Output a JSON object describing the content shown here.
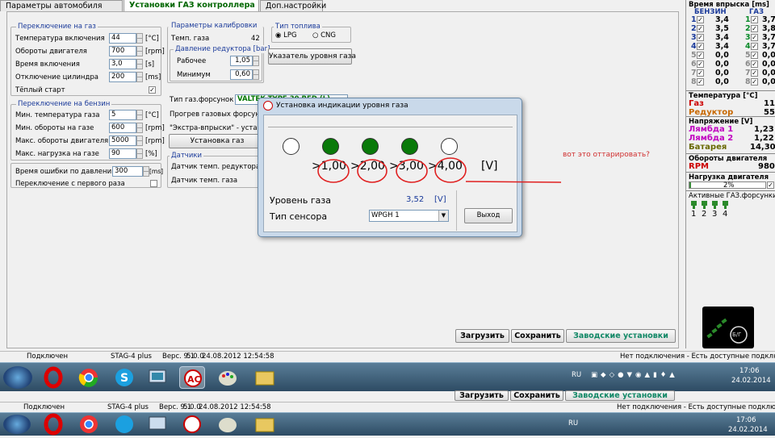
{
  "tabs": [
    "Параметры автомобиля",
    "Установки ГАЗ контроллера",
    "Доп.настройки"
  ],
  "switch_gas": {
    "title": "Переключение на газ",
    "rows": [
      {
        "label": "Температура включения",
        "value": "44",
        "unit": "[°C]"
      },
      {
        "label": "Обороты двигателя",
        "value": "700",
        "unit": "[rpm]"
      },
      {
        "label": "Время включения",
        "value": "3,0",
        "unit": "[s]"
      },
      {
        "label": "Отключение цилиндра",
        "value": "200",
        "unit": "[ms]"
      }
    ],
    "warm_start": "Тёплый старт"
  },
  "switch_petrol": {
    "title": "Переключение на бензин",
    "rows": [
      {
        "label": "Мин. температура газа",
        "value": "5",
        "unit": "[°C]"
      },
      {
        "label": "Мин. обороты на газе",
        "value": "600",
        "unit": "[rpm]"
      },
      {
        "label": "Макс. обороты двигателя",
        "value": "5000",
        "unit": "[rpm]"
      },
      {
        "label": "Макс. нагрузка на газе",
        "value": "90",
        "unit": "[%]"
      }
    ]
  },
  "pressure_err": {
    "label": "Время ошибки по давлению",
    "value": "300",
    "unit": "[ms]"
  },
  "first_switch": "Переключение с первого раза",
  "calib": {
    "title": "Параметры калибровки",
    "gas_temp_label": "Темп. газа",
    "gas_temp_value": "42",
    "reducer_title": "Давление редуктора [bar]",
    "work_label": "Рабочее",
    "work_value": "1,05",
    "min_label": "Минимум",
    "min_value": "0,60"
  },
  "fuel": {
    "title": "Тип топлива",
    "lpg": "LPG",
    "cng": "CNG"
  },
  "level_btn": "Указатель уровня газа",
  "injectors": {
    "label": "Тип газ.форсунок",
    "value": "VALTEK TYPE 30 RED (L)",
    "preheat": "Прогрев газовых форсунок",
    "extra": "\"Экстра-впрыски\" - установ",
    "install": "Установка газ"
  },
  "sensors": {
    "title": "Датчики",
    "reducer": "Датчик темп. редуктора",
    "gas": "Датчик темп. газа"
  },
  "buttons": {
    "load": "Загрузить",
    "save": "Сохранить",
    "factory": "Заводские установки"
  },
  "annotation": "вот это оттарировать?",
  "right": {
    "inj_title": "Время впрыска [ms]",
    "petrol": "БЕНЗИН",
    "gas": "ГАЗ",
    "inj": [
      {
        "n": "1",
        "b": "3,4",
        "g": "3,7"
      },
      {
        "n": "2",
        "b": "3,5",
        "g": "3,8"
      },
      {
        "n": "3",
        "b": "3,4",
        "g": "3,7"
      },
      {
        "n": "4",
        "b": "3,4",
        "g": "3,7"
      },
      {
        "n": "5",
        "b": "0,0",
        "g": "0,0"
      },
      {
        "n": "6",
        "b": "0,0",
        "g": "0,0"
      },
      {
        "n": "7",
        "b": "0,0",
        "g": "0,0"
      },
      {
        "n": "8",
        "b": "0,0",
        "g": "0,0"
      }
    ],
    "temp_title": "Температура [°C]",
    "gas_label": "Газ",
    "gas_val": "11",
    "reducer_label": "Редуктор",
    "reducer_val": "55",
    "volt_title": "Напряжение [V]",
    "l1": "Лямбда 1",
    "l1v": "1,23",
    "l2": "Лямбда 2",
    "l2v": "1,22",
    "bat": "Батарея",
    "batv": "14,30",
    "rpm_title": "Обороты двигателя",
    "rpm_label": "RPM",
    "rpm_val": "980",
    "load_title": "Нагрузка двигателя",
    "load_val": "2%",
    "load_frac": 0.02,
    "active_title": "Активные ГАЗ.форсунки",
    "active_nums": [
      "1",
      "2",
      "3",
      "4"
    ],
    "switch_label": "Б/Г"
  },
  "status": {
    "state": "Подключен",
    "device": "STAG-4 plus",
    "ver": "Верс. 9.1",
    "fw": "5.0.0",
    "date": "24.08.2012 12:54:58",
    "conn": "Нет подключения - Есть доступные подключения"
  },
  "tray": {
    "lang": "RU",
    "time": "17:06",
    "date": "24.02.2014"
  },
  "dialog": {
    "title": "Установка индикации уровня газа",
    "leds": [
      "off",
      "on",
      "on",
      "on",
      "off"
    ],
    "thresholds": [
      "1,00",
      "2,00",
      "3,00",
      "4,00"
    ],
    "unit": "[V]",
    "level_label": "Уровень газа",
    "level_value": "3,52",
    "level_unit": "[V]",
    "sensor_label": "Тип сенсора",
    "sensor_value": "WPGH 1",
    "exit": "Выход"
  }
}
